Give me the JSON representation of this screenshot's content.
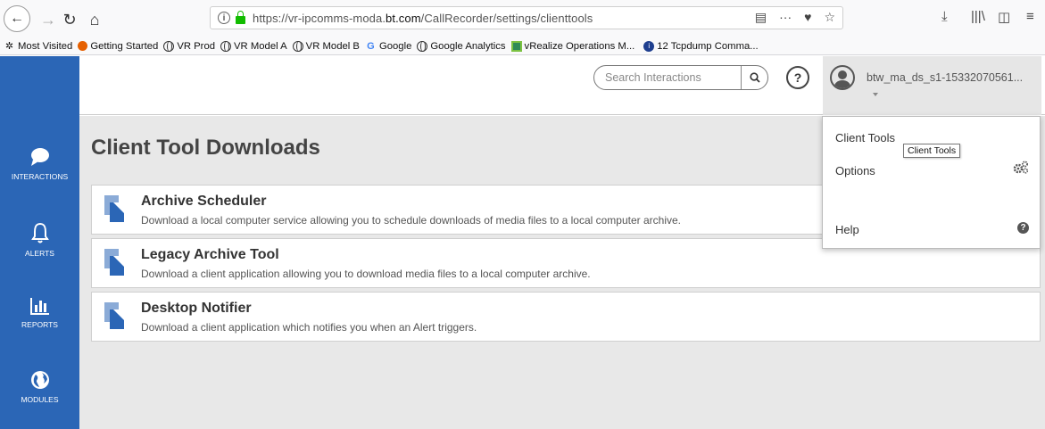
{
  "browser": {
    "url_prefix": "https://vr-ipcomms-moda.",
    "url_domain": "bt.com",
    "url_suffix": "/CallRecorder/settings/clienttools",
    "more_icon": "···"
  },
  "bookmarks": [
    {
      "label": "Most Visited",
      "icon": "gear-icon"
    },
    {
      "label": "Getting Started",
      "icon": "firefox-icon"
    },
    {
      "label": "VR Prod",
      "icon": "globe-icon"
    },
    {
      "label": "VR Model A",
      "icon": "globe-icon"
    },
    {
      "label": "VR Model B",
      "icon": "globe-icon"
    },
    {
      "label": "Google",
      "icon": "google-icon"
    },
    {
      "label": "Google Analytics",
      "icon": "globe-icon"
    },
    {
      "label": "vRealize Operations M...",
      "icon": "vrealize-icon"
    },
    {
      "label": "12 Tcpdump Comma...",
      "icon": "info-icon"
    }
  ],
  "sidebar": {
    "items": [
      {
        "label": "INTERACTIONS",
        "icon": "chat-icon"
      },
      {
        "label": "ALERTS",
        "icon": "bell-icon"
      },
      {
        "label": "REPORTS",
        "icon": "chart-icon"
      },
      {
        "label": "MODULES",
        "icon": "globe-icon"
      }
    ]
  },
  "header": {
    "search_placeholder": "Search Interactions",
    "help_label": "?",
    "username": "btw_ma_ds_s1-15332070561..."
  },
  "main": {
    "title": "Client Tool Downloads",
    "tools": [
      {
        "title": "Archive Scheduler",
        "description": "Download a local computer service allowing you to schedule downloads of media files to a local computer archive."
      },
      {
        "title": "Legacy Archive Tool",
        "description": "Download a client application allowing you to download media files to a local computer archive."
      },
      {
        "title": "Desktop Notifier",
        "description": "Download a client application which notifies you when an Alert triggers."
      }
    ]
  },
  "dropdown": {
    "items": [
      {
        "label": "Client Tools"
      },
      {
        "label": "Options",
        "icon": "gears-icon"
      },
      {
        "label": "Help",
        "icon": "question-icon"
      }
    ],
    "tooltip": "Client Tools"
  },
  "colors": {
    "sidebar": "#2b66b6",
    "main_bg": "#e8e8e8"
  }
}
